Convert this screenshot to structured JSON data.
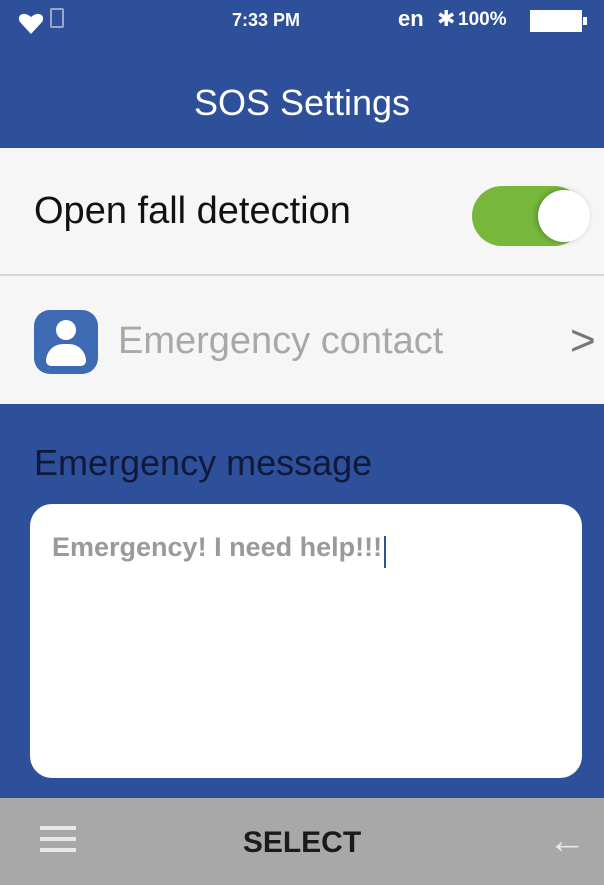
{
  "status_bar": {
    "time": "7:33 PM",
    "language": "en",
    "bluetooth_icon": "bluetooth-icon",
    "battery": "100%",
    "icons": [
      "heart-icon",
      "sim-card-icon",
      "bluetooth-icon",
      "battery-icon"
    ]
  },
  "header": {
    "title": "SOS Settings"
  },
  "fall_detection": {
    "label": "Open fall detection",
    "enabled": true
  },
  "emergency_contact": {
    "label": "Emergency contact",
    "icon": "contact-icon",
    "chevron": ">"
  },
  "emergency_message": {
    "label": "Emergency message",
    "value": "Emergency! I need help!!!"
  },
  "bottom_bar": {
    "menu_icon": "menu-icon",
    "select_label": "SELECT",
    "back_icon": "back-arrow-icon"
  },
  "colors": {
    "primary": "#2e4f9a",
    "toggle_on": "#77b83c",
    "bottom_bar": "#a8a8a8"
  }
}
